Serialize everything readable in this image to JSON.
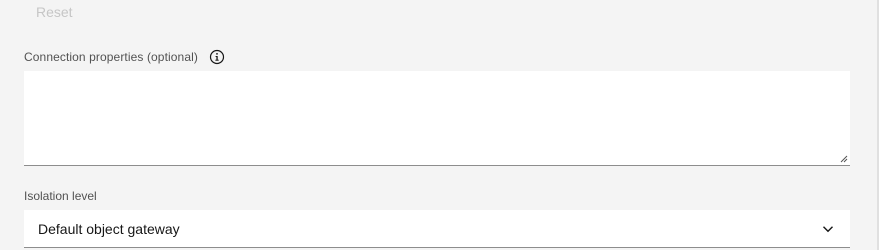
{
  "reset": {
    "label": "Reset"
  },
  "connection_properties": {
    "label": "Connection properties (optional)",
    "icon": "info-icon",
    "value": ""
  },
  "isolation_level": {
    "label": "Isolation level",
    "selected": "Default object gateway",
    "icon": "chevron-down-icon"
  },
  "colors": {
    "background": "#f4f4f4",
    "field": "#ffffff",
    "label": "#525252",
    "disabled": "#c6c6c6"
  }
}
